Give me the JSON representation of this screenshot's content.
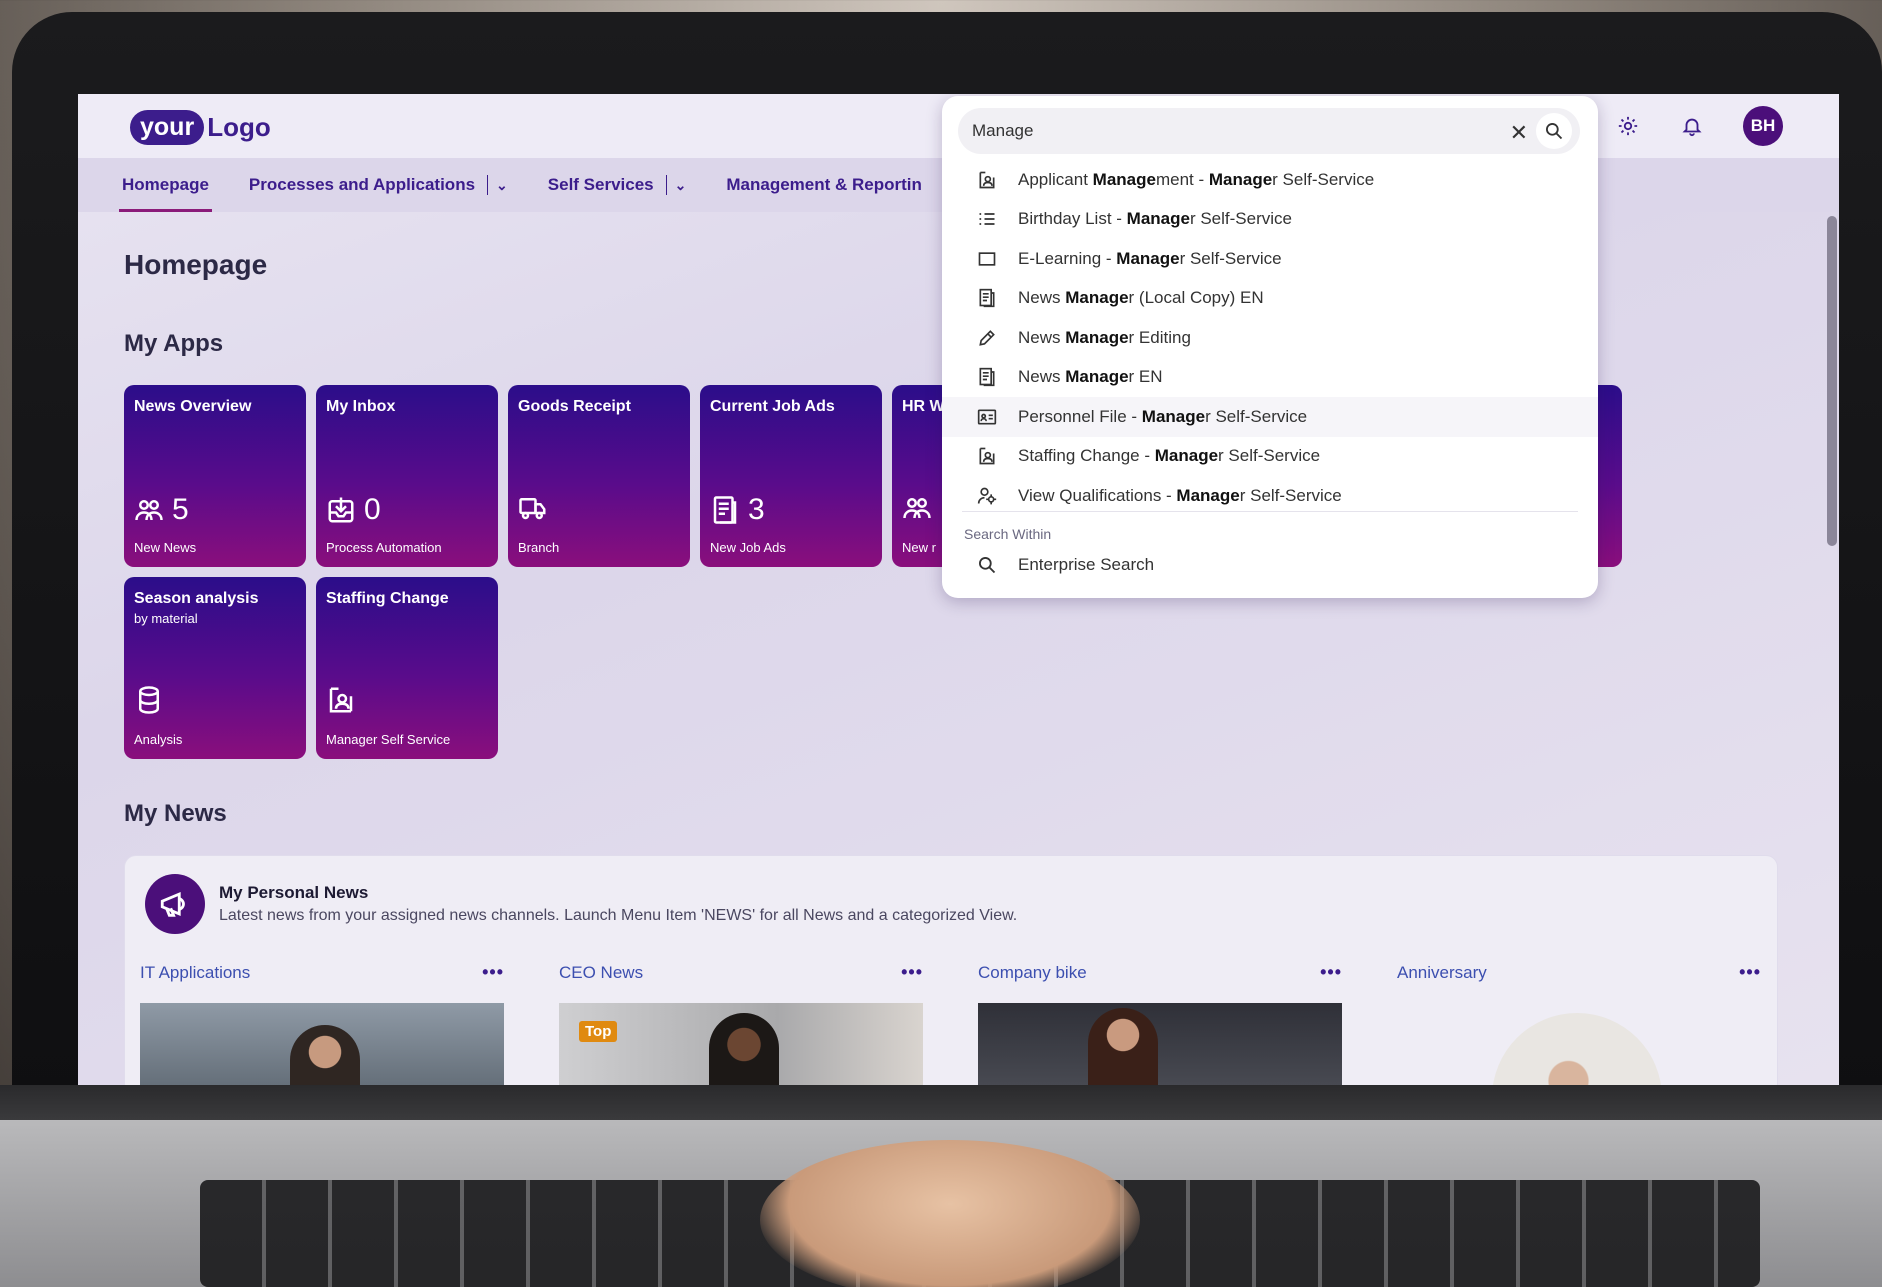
{
  "logo": {
    "your": "your",
    "logo": "Logo"
  },
  "user": {
    "initials": "BH"
  },
  "nav": {
    "items": [
      "Homepage",
      "Processes and Applications",
      "Self Services",
      "Management & Reportin"
    ]
  },
  "page": {
    "title": "Homepage"
  },
  "sections": {
    "apps": "My Apps",
    "news": "My News"
  },
  "tiles": [
    {
      "title": "News Overview",
      "subtitle": "",
      "value": "5",
      "footer": "New News",
      "icon": "people-icon"
    },
    {
      "title": "My Inbox",
      "subtitle": "",
      "value": "0",
      "footer": "Process Automation",
      "icon": "inbox-icon"
    },
    {
      "title": "Goods Receipt",
      "subtitle": "",
      "value": "",
      "footer": "Branch",
      "icon": "truck-icon"
    },
    {
      "title": "Current Job Ads",
      "subtitle": "",
      "value": "3",
      "footer": "New Job Ads",
      "icon": "document-icon"
    },
    {
      "title": "HR W",
      "subtitle": "",
      "value": "",
      "footer": "New r",
      "icon": "people-icon"
    },
    {
      "title": "Season analysis",
      "subtitle": "by material",
      "value": "",
      "footer": "Analysis",
      "icon": "database-icon"
    },
    {
      "title": "Staffing Change",
      "subtitle": "",
      "value": "",
      "footer": "Manager Self Service",
      "icon": "badge-icon"
    }
  ],
  "personal_news": {
    "title": "My Personal News",
    "description": "Latest news from your assigned news channels. Launch Menu Item 'NEWS' for all News and a categorized View.",
    "channels": [
      "IT Applications",
      "CEO News",
      "Company bike",
      "Anniversary"
    ],
    "more": "•••",
    "badge": "Top"
  },
  "search": {
    "query": "Manage",
    "suggestions": [
      {
        "pre": "Applicant ",
        "bold": "Manage",
        "mid": "ment - ",
        "bold2": "Manage",
        "post": "r Self-Service",
        "icon": "badge-icon"
      },
      {
        "pre": "Birthday List - ",
        "bold": "Manage",
        "mid": "r Self-Service",
        "bold2": "",
        "post": "",
        "icon": "list-icon"
      },
      {
        "pre": "E-Learning - ",
        "bold": "Manage",
        "mid": "r Self-Service",
        "bold2": "",
        "post": "",
        "icon": "square-icon"
      },
      {
        "pre": "News ",
        "bold": "Manage",
        "mid": "r (Local Copy) EN",
        "bold2": "",
        "post": "",
        "icon": "document-icon"
      },
      {
        "pre": "News ",
        "bold": "Manage",
        "mid": "r Editing",
        "bold2": "",
        "post": "",
        "icon": "edit-icon"
      },
      {
        "pre": "News ",
        "bold": "Manage",
        "mid": "r EN",
        "bold2": "",
        "post": "",
        "icon": "document-icon"
      },
      {
        "pre": "Personnel File - ",
        "bold": "Manage",
        "mid": "r Self-Service",
        "bold2": "",
        "post": "",
        "icon": "id-card-icon"
      },
      {
        "pre": "Staffing Change - ",
        "bold": "Manage",
        "mid": "r Self-Service",
        "bold2": "",
        "post": "",
        "icon": "badge-icon"
      },
      {
        "pre": "View Qualifications - ",
        "bold": "Manage",
        "mid": "r Self-Service",
        "bold2": "",
        "post": "",
        "icon": "qualification-icon"
      }
    ],
    "within_label": "Search Within",
    "enterprise": "Enterprise Search"
  }
}
